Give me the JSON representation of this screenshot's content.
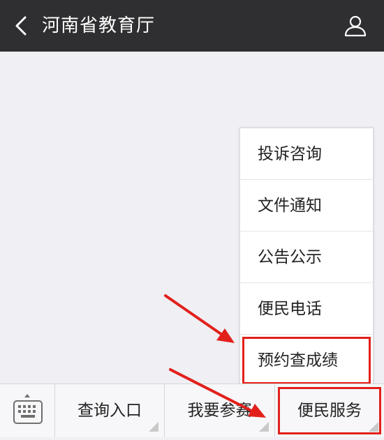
{
  "header": {
    "back_icon": "chevron-left-icon",
    "title": "河南省教育厅",
    "profile_icon": "user-icon"
  },
  "popup_menu": {
    "items": [
      {
        "label": "投诉咨询"
      },
      {
        "label": "文件通知"
      },
      {
        "label": "公告公示"
      },
      {
        "label": "便民电话"
      },
      {
        "label": "预约查成绩",
        "highlighted": true
      }
    ]
  },
  "bottom_bar": {
    "keyboard_icon": "keyboard-icon",
    "tabs": [
      {
        "label": "查询入口"
      },
      {
        "label": "我要参赛"
      },
      {
        "label": "便民服务",
        "highlighted": true
      }
    ]
  },
  "colors": {
    "header_bg": "#2f2f31",
    "page_bg": "#efeff4",
    "annotation_red": "#e2201b"
  }
}
